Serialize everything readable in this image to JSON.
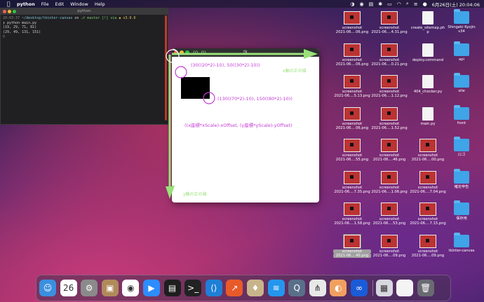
{
  "menubar": {
    "app": "python",
    "items": [
      "File",
      "Edit",
      "Window",
      "Help"
    ],
    "datetime": "6月26日(土) 20:04:06"
  },
  "terminal": {
    "title": "python",
    "lines": [
      {
        "time": "20:03:37",
        "dir": "~/desktop/tkinter-canvas",
        "on": "on",
        "branch": "master [!] via",
        "ver": "v3.9.6"
      },
      {
        "text": "❯ python main.py"
      },
      {
        "text": "(19, 29, 71, 81)"
      },
      {
        "text": "(29, 49, 131, 151)"
      },
      {
        "text": "▯"
      }
    ]
  },
  "tk": {
    "title": "tk",
    "origin": "(0, 0)",
    "top_left_label": "(30((20*2)-10), 50((30*2)-10))",
    "bottom_right_label": "(130((70*2)-10), 150((80*2)-10))",
    "formula": "((x座標*xScale)-xOffset, (y座標*yScale)-yOffset)",
    "x_axis_label": "x軸の正の値",
    "y_axis_label": "y軸の正の値",
    "accent_green": "#9be07b",
    "accent_purple": "#c43bd4"
  },
  "desktop": {
    "icons": [
      {
        "name": "screenshot-1",
        "l1": "screenshot",
        "l2": "2021-06....06.png",
        "kind": "thumb"
      },
      {
        "name": "screenshot-2",
        "l1": "screenshot",
        "l2": "2021-06....4.31.png",
        "kind": "thumb"
      },
      {
        "name": "create-sitemap",
        "l1": "create_sitemap.ph",
        "l2": "p",
        "kind": "doc"
      },
      {
        "name": "shingeki",
        "l1": "Shingeki Kyojin",
        "l2": "v34",
        "kind": "folder"
      },
      {
        "name": "screenshot-3",
        "l1": "screenshot",
        "l2": "2021-06....06.png",
        "kind": "thumb"
      },
      {
        "name": "screenshot-4",
        "l1": "screenshot",
        "l2": "2021-06....0.21.png",
        "kind": "thumb"
      },
      {
        "name": "deploy-command",
        "l1": "deploy.command",
        "l2": "",
        "kind": "doc"
      },
      {
        "name": "api",
        "l1": "api",
        "l2": "",
        "kind": "folder"
      },
      {
        "name": "screenshot-5",
        "l1": "screenshot",
        "l2": "2021-06....5.13.png",
        "kind": "thumb"
      },
      {
        "name": "screenshot-6",
        "l1": "screenshot",
        "l2": "2021-06....1.12.png",
        "kind": "thumb"
      },
      {
        "name": "404-checker",
        "l1": "404_checker.py",
        "l2": "",
        "kind": "doc"
      },
      {
        "name": "site",
        "l1": "site",
        "l2": "",
        "kind": "folder"
      },
      {
        "name": "screenshot-7",
        "l1": "screenshot",
        "l2": "2021-06....06.png",
        "kind": "thumb"
      },
      {
        "name": "screenshot-8",
        "l1": "screenshot",
        "l2": "2021-06....1.52.png",
        "kind": "thumb"
      },
      {
        "name": "main-py",
        "l1": "main.py",
        "l2": "",
        "kind": "doc"
      },
      {
        "name": "front",
        "l1": "front",
        "l2": "",
        "kind": "folder"
      },
      {
        "name": "screenshot-9",
        "l1": "screenshot",
        "l2": "2021-06....55.png",
        "kind": "thumb"
      },
      {
        "name": "screenshot-10",
        "l1": "screenshot",
        "l2": "2021-06....46.png",
        "kind": "thumb"
      },
      {
        "name": "screenshot-11",
        "l1": "screenshot",
        "l2": "2021-06....00.png",
        "kind": "thumb"
      },
      {
        "name": "logo",
        "l1": "ロゴ",
        "l2": "",
        "kind": "folder"
      },
      {
        "name": "screenshot-12",
        "l1": "screenshot",
        "l2": "2021-06....7.35.png",
        "kind": "thumb"
      },
      {
        "name": "screenshot-13",
        "l1": "screenshot",
        "l2": "2021-06....1.06.png",
        "kind": "thumb"
      },
      {
        "name": "screenshot-14",
        "l1": "screenshot",
        "l2": "2021-06....7.04.png",
        "kind": "thumb"
      },
      {
        "name": "kakutei",
        "l1": "確定申告",
        "l2": "",
        "kind": "folder"
      },
      {
        "name": "screenshot-15",
        "l1": "screenshot",
        "l2": "2021-06....1.58.png",
        "kind": "thumb"
      },
      {
        "name": "screenshot-16",
        "l1": "screenshot",
        "l2": "2021-06....53.png",
        "kind": "thumb"
      },
      {
        "name": "screenshot-17",
        "l1": "screenshot",
        "l2": "2021-06....7.15.png",
        "kind": "thumb"
      },
      {
        "name": "hozonyo",
        "l1": "保存用",
        "l2": "",
        "kind": "folder"
      },
      {
        "name": "screenshot-18",
        "l1": "screenshot",
        "l2": "2021-06....40.png",
        "kind": "thumb",
        "selected": true
      },
      {
        "name": "screenshot-19",
        "l1": "screenshot",
        "l2": "2021-06....09.png",
        "kind": "thumb"
      },
      {
        "name": "screenshot-20",
        "l1": "screenshot",
        "l2": "2021-06....09.png",
        "kind": "thumb"
      },
      {
        "name": "tkinter-canvas",
        "l1": "tkinter-canvas",
        "l2": "",
        "kind": "folder"
      }
    ]
  },
  "dock": {
    "apps": [
      {
        "name": "finder-icon",
        "color": "#3b8fe0",
        "glyph": "☺"
      },
      {
        "name": "calendar-icon",
        "color": "#ffffff",
        "glyph": "26"
      },
      {
        "name": "system-preferences-icon",
        "color": "#8a8a8a",
        "glyph": "⚙"
      },
      {
        "name": "archive-icon",
        "color": "#b08a5a",
        "glyph": "▣"
      },
      {
        "name": "chrome-icon",
        "color": "#ffffff",
        "glyph": "◉"
      },
      {
        "name": "zoom-icon",
        "color": "#2d8cff",
        "glyph": "▶"
      },
      {
        "name": "activity-terminal-icon",
        "color": "#1e1e1e",
        "glyph": "▤"
      },
      {
        "name": "terminal-icon",
        "color": "#222222",
        "glyph": ">_"
      },
      {
        "name": "vscode-icon",
        "color": "#1e7fd6",
        "glyph": "⟨⟩"
      },
      {
        "name": "stats-icon",
        "color": "#e85a2a",
        "glyph": "↗"
      },
      {
        "name": "cyberduck-icon",
        "color": "#c8b48a",
        "glyph": "♦"
      },
      {
        "name": "docker-icon",
        "color": "#2496ed",
        "glyph": "≋"
      },
      {
        "name": "quicktime-icon",
        "color": "#5a6f8a",
        "glyph": "Q"
      },
      {
        "name": "sourcetree-icon",
        "color": "#e8e8e8",
        "glyph": "⋔"
      },
      {
        "name": "screenshot-app-icon",
        "color": "#f0a060",
        "glyph": "◐"
      },
      {
        "name": "infinity-icon",
        "color": "#1a5bd8",
        "glyph": "∞"
      },
      {
        "name": "preview-icon",
        "color": "#d8d8e0",
        "glyph": "▦"
      },
      {
        "name": "document-icon",
        "color": "#f4f4f4",
        "glyph": ""
      },
      {
        "name": "trash-icon",
        "color": "#6a6a72",
        "glyph": "🗑"
      }
    ]
  }
}
